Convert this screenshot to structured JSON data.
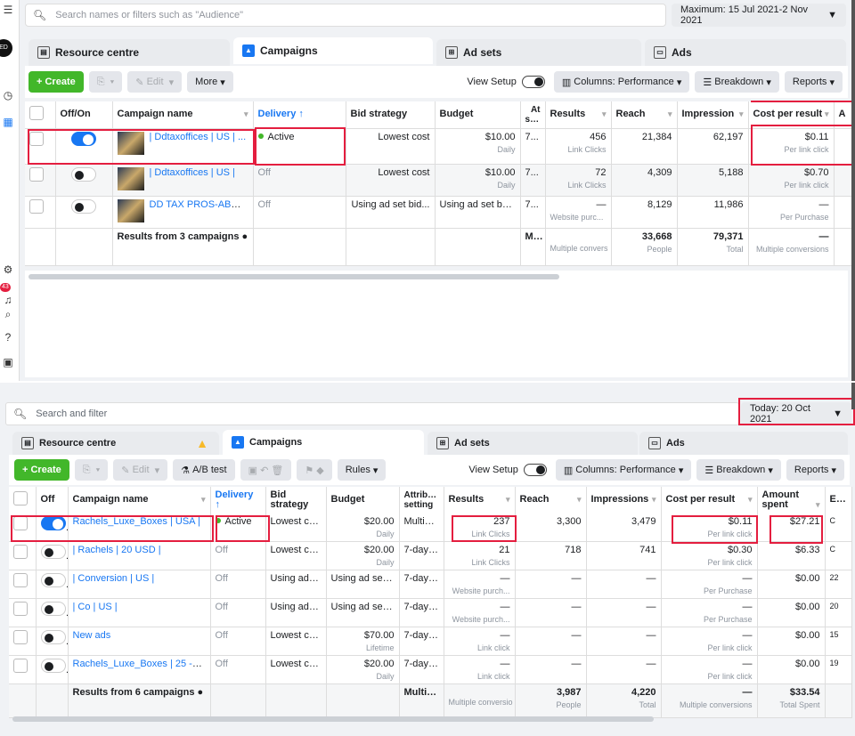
{
  "p1": {
    "rail_notif": "43",
    "search_placeholder": "Search names or filters such as \"Audience\"",
    "date_range": "Maximum: 15 Jul 2021-2 Nov 2021",
    "tabs": [
      "Resource centre",
      "Campaigns",
      "Ad sets",
      "Ads"
    ],
    "toolbar": {
      "create": "Create",
      "edit": "Edit",
      "more": "More",
      "view_setup": "View Setup",
      "columns": "Columns: Performance",
      "breakdown": "Breakdown",
      "reports": "Reports"
    },
    "headers": [
      "Off/On",
      "Campaign name",
      "Delivery ↑",
      "Bid strategy",
      "Budget",
      "At sett",
      "Results",
      "Reach",
      "Impression",
      "Cost per result",
      "A"
    ],
    "rows": [
      {
        "name": "| Ddtaxoffices | US | ...",
        "delivery": "Active",
        "bid": "Lowest cost",
        "budget": "$10.00",
        "budget_sub": "Daily",
        "at": "7...",
        "results": "456",
        "results_sub": "Link Clicks",
        "reach": "21,384",
        "impr": "62,197",
        "cpr": "$0.11",
        "cpr_sub": "Per link click",
        "on": true
      },
      {
        "name": "| Ddtaxoffices | US |",
        "delivery": "Off",
        "bid": "Lowest cost",
        "budget": "$10.00",
        "budget_sub": "Daily",
        "at": "7...",
        "results": "72",
        "results_sub": "Link Clicks",
        "reach": "4,309",
        "impr": "5,188",
        "cpr": "$0.70",
        "cpr_sub": "Per link click",
        "on": false
      },
      {
        "name": "DD TAX PROS-ABO-...",
        "delivery": "Off",
        "bid": "Using ad set bid...",
        "budget": "Using ad set bu...",
        "budget_sub": "",
        "at": "7...",
        "results": "—",
        "results_sub": "Website purc...",
        "reach": "8,129",
        "impr": "11,986",
        "cpr": "—",
        "cpr_sub": "Per Purchase",
        "on": false
      }
    ],
    "summary": {
      "label": "Results from 3 campaigns",
      "at": "M...",
      "results_sub": "Multiple convers",
      "reach": "33,668",
      "reach_sub": "People",
      "impr": "79,371",
      "impr_sub": "Total",
      "cpr": "—",
      "cpr_sub": "Multiple conversions"
    }
  },
  "p2": {
    "search_placeholder": "Search and filter",
    "date_range": "Today: 20 Oct 2021",
    "tabs": [
      "Resource centre",
      "Campaigns",
      "Ad sets",
      "Ads"
    ],
    "toolbar": {
      "create": "Create",
      "edit": "Edit",
      "ab": "A/B test",
      "rules": "Rules",
      "view_setup": "View Setup",
      "columns": "Columns: Performance",
      "breakdown": "Breakdown",
      "reports": "Reports"
    },
    "headers": [
      "Off",
      "Campaign name",
      "Delivery ↑",
      "Bid strategy",
      "Budget",
      "Attribution setting",
      "Results",
      "Reach",
      "Impressions",
      "Cost per result",
      "Amount spent",
      "Ends"
    ],
    "rows": [
      {
        "name": "Rachels_Luxe_Boxes | USA |",
        "delivery": "Active",
        "bid": "Lowest cost",
        "budget": "$20.00",
        "budget_sub": "Daily",
        "attr": "Multipl...",
        "results": "237",
        "results_sub": "Link Clicks",
        "reach": "3,300",
        "impr": "3,479",
        "cpr": "$0.11",
        "cpr_sub": "Per link click",
        "spent": "$27.21",
        "ends": "C",
        "on": true
      },
      {
        "name": "| Rachels | 20 USD |",
        "delivery": "Off",
        "bid": "Lowest cost",
        "budget": "$20.00",
        "budget_sub": "Daily",
        "attr": "7-day c...",
        "results": "21",
        "results_sub": "Link Clicks",
        "reach": "718",
        "impr": "741",
        "cpr": "$0.30",
        "cpr_sub": "Per link click",
        "spent": "$6.33",
        "ends": "C",
        "on": false
      },
      {
        "name": "| Conversion | US |",
        "delivery": "Off",
        "bid": "Using ad s...",
        "budget": "Using ad set b...",
        "budget_sub": "",
        "attr": "7-day c...",
        "results": "—",
        "results_sub": "Website purch...",
        "reach": "—",
        "impr": "—",
        "cpr": "—",
        "cpr_sub": "Per Purchase",
        "spent": "$0.00",
        "ends": "22",
        "on": false
      },
      {
        "name": "| Co | US |",
        "delivery": "Off",
        "bid": "Using ad s...",
        "budget": "Using ad set b...",
        "budget_sub": "",
        "attr": "7-day c...",
        "results": "—",
        "results_sub": "Website purch...",
        "reach": "—",
        "impr": "—",
        "cpr": "—",
        "cpr_sub": "Per Purchase",
        "spent": "$0.00",
        "ends": "20",
        "on": false
      },
      {
        "name": "New ads",
        "delivery": "Off",
        "bid": "Lowest cost",
        "budget": "$70.00",
        "budget_sub": "Lifetime",
        "attr": "7-day c...",
        "results": "—",
        "results_sub": "Link click",
        "reach": "—",
        "impr": "—",
        "cpr": "—",
        "cpr_sub": "Per link click",
        "spent": "$0.00",
        "ends": "15",
        "on": false
      },
      {
        "name": "Rachels_Luxe_Boxes | 25 -45 |",
        "delivery": "Off",
        "bid": "Lowest cost",
        "budget": "$20.00",
        "budget_sub": "Daily",
        "attr": "7-day c...",
        "results": "—",
        "results_sub": "Link click",
        "reach": "—",
        "impr": "—",
        "cpr": "—",
        "cpr_sub": "Per link click",
        "spent": "$0.00",
        "ends": "19",
        "on": false
      }
    ],
    "summary": {
      "label": "Results from 6 campaigns",
      "attr": "Multiple...",
      "results_sub": "Multiple conversio",
      "reach": "3,987",
      "reach_sub": "People",
      "impr": "4,220",
      "impr_sub": "Total",
      "cpr": "—",
      "cpr_sub": "Multiple conversions",
      "spent": "$33.54",
      "spent_sub": "Total Spent"
    }
  }
}
